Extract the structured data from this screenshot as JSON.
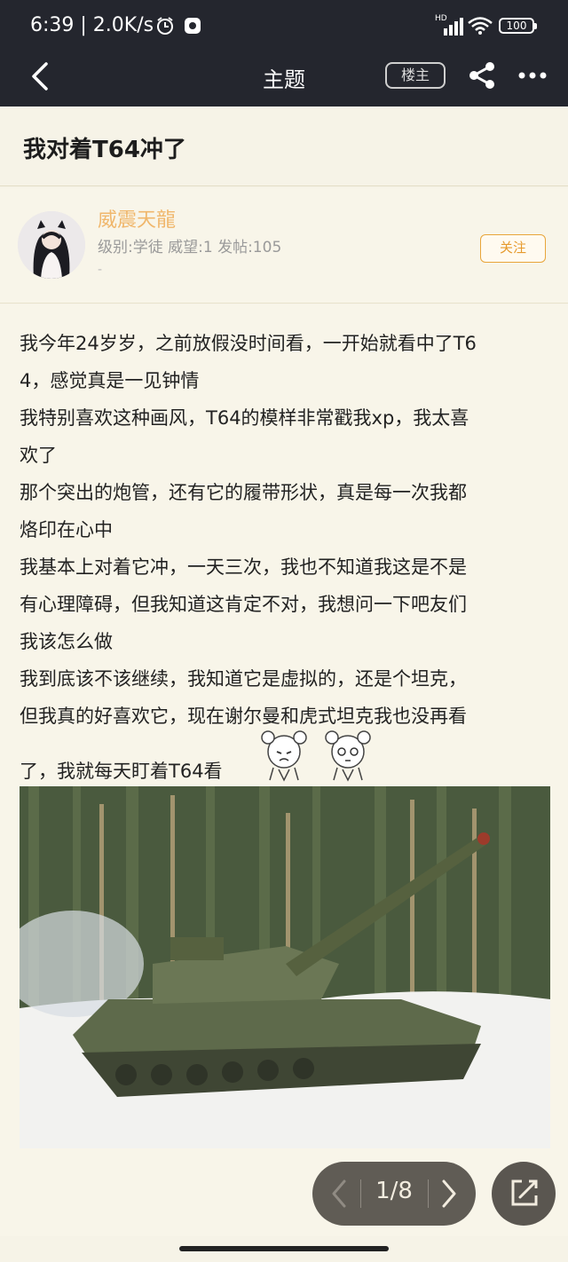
{
  "status_bar": {
    "time": "6:39 | 2.0K/s",
    "battery": "100",
    "network": "HD"
  },
  "nav": {
    "title": "主题",
    "owner_label": "楼主"
  },
  "thread": {
    "title": "我对着T64冲了"
  },
  "author": {
    "name": "威震天龍",
    "meta": "级别:学徒 威望:1 发帖:105",
    "dash": "-",
    "follow_label": "关注"
  },
  "post": {
    "lines": [
      "我今年24岁岁，之前放假没时间看，一开始就看中了T6",
      "4，感觉真是一见钟情",
      "我特别喜欢这种画风，T64的模样非常戳我xp，我太喜",
      "欢了",
      "那个突出的炮管，还有它的履带形状，真是每一次我都",
      "烙印在心中",
      "我基本上对着它冲，一天三次，我也不知道我这是不是",
      "有心理障碍，但我知道这肯定不对，我想问一下吧友们",
      "我该怎么做",
      "我到底该不该继续，我知道它是虚拟的，还是个坦克，",
      "但我真的好喜欢它，现在谢尔曼和虎式坦克我也没再看",
      "了，我就每天盯着T64看"
    ]
  },
  "pager": {
    "label": "1/8"
  },
  "colors": {
    "topbar": "#24262e",
    "background": "#f6f3e7",
    "accent": "#e69a2d",
    "author_name": "#f0b76c"
  }
}
